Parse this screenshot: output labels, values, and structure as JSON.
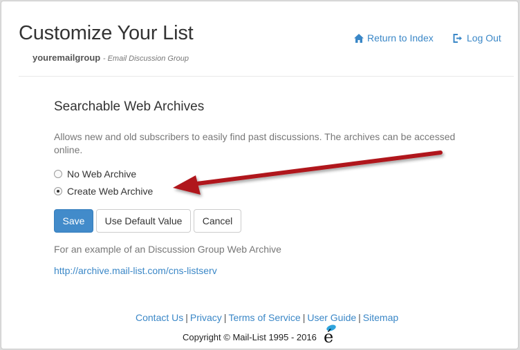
{
  "header": {
    "title": "Customize Your List",
    "group_name": "youremailgroup",
    "group_desc": "- Email Discussion Group",
    "return_label": "Return to Index",
    "logout_label": "Log Out"
  },
  "section": {
    "title": "Searchable Web Archives",
    "description": "Allows new and old subscribers to easily find past discussions. The archives can be accessed online.",
    "options": [
      {
        "label": "No Web Archive",
        "selected": false
      },
      {
        "label": "Create Web Archive",
        "selected": true
      }
    ]
  },
  "buttons": {
    "save": "Save",
    "default": "Use Default Value",
    "cancel": "Cancel"
  },
  "example": {
    "text": "For an example of an Discussion Group Web Archive",
    "link": "http://archive.mail-list.com/cns-listserv"
  },
  "footer": {
    "links": [
      "Contact Us",
      "Privacy",
      "Terms of Service",
      "User Guide",
      "Sitemap"
    ],
    "copyright": "Copyright © Mail-List 1995 - 2016"
  },
  "colors": {
    "link": "#3a87c7",
    "primary_button": "#428bca",
    "annotation_arrow": "#b0181c"
  },
  "icons": {
    "return": "home-icon",
    "logout": "logout-icon",
    "logo": "mail-list-logo-icon"
  }
}
